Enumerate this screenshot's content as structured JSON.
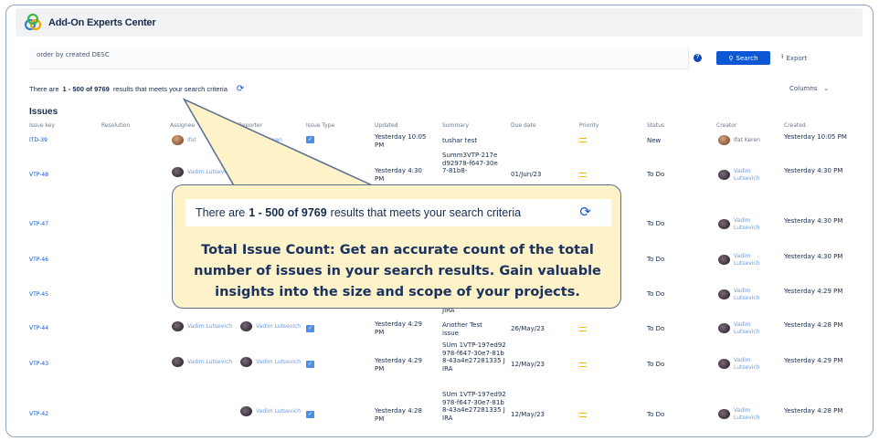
{
  "app": {
    "title": "Add-On Experts Center"
  },
  "query": {
    "text": "order by created DESC"
  },
  "toolbar": {
    "help": "?",
    "search_label": "Search",
    "export_label": "Export",
    "columns_label": "Columns"
  },
  "results": {
    "prefix": "There are",
    "range": "1 - 500 of 9769",
    "suffix": "results that meets your search criteria"
  },
  "issues": {
    "heading": "Issues",
    "columns": [
      "Issue key",
      "Resolution",
      "Assignee",
      "Reporter",
      "Issue Type",
      "Updated",
      "Summary",
      "Due date",
      "Priority",
      "Status",
      "Creator",
      "Created"
    ],
    "rows": [
      {
        "key": "ITD-39",
        "assignee": "Ifat",
        "reporter": "Ifat Keren",
        "updated": "Yesterday 10:05 PM",
        "summary": "tushar test",
        "due": "",
        "status": "New",
        "creator": "Ifat Keren",
        "created": "Yesterday 10:05 PM"
      },
      {
        "key": "VTP-48",
        "assignee": "Vadim Lutsevich",
        "reporter": "",
        "updated": "Yesterday 4:30 PM",
        "summary": "Summ3VTP-217ed92978-f647-30e7-81b8-",
        "due": "01/Jun/23",
        "status": "To Do",
        "creator": "Vadim Lutsevich",
        "created": "Yesterday 4:30 PM"
      },
      {
        "key": "VTP-47",
        "status": "To Do",
        "creator": "Vadim Lutsevich",
        "created": "Yesterday 4:30 PM"
      },
      {
        "key": "VTP-46",
        "status": "To Do",
        "creator": "Vadim Lutsevich",
        "created": "Yesterday 4:30 PM"
      },
      {
        "key": "VTP-45",
        "status": "To Do",
        "creator": "Vadim Lutsevich",
        "created": "Yesterday 4:29 PM"
      },
      {
        "key": "VTP-44",
        "assignee": "Vadim Lutsevich",
        "reporter": "Vadim Lutsevich",
        "updated": "Yesterday 4:29 PM",
        "summary_top": "JIRA",
        "summary": "Another Test issue",
        "due": "26/May/23",
        "status": "To Do",
        "creator": "Vadim Lutsevich",
        "created": "Yesterday 4:28 PM"
      },
      {
        "key": "VTP-43",
        "assignee": "Vadim Lutsevich",
        "reporter": "Vadim Lutsevich",
        "updated": "Yesterday 4:29 PM",
        "summary": "SUm 1VTP-197ed92978-f647-30e7-81b8-43a4e27281335 JIRA",
        "due": "12/May/23",
        "status": "To Do",
        "creator": "Vadim Lutsevich",
        "created": "Yesterday 4:29 PM"
      },
      {
        "key": "VTP-42",
        "assignee": "",
        "reporter": "Vadim Lutsevich",
        "updated": "Yesterday 4:28 PM",
        "summary": "SUm 1VTP-197ed92978-f647-30e7-81b8-43a4e27281335 JIRA",
        "due": "12/May/23",
        "status": "To Do",
        "creator": "Vadim Lutsevich",
        "created": "Yesterday 4:28 PM"
      }
    ]
  },
  "callout": {
    "prefix": "There are",
    "range": "1 - 500 of 9769",
    "suffix": "results that meets your search criteria",
    "lines": [
      "Total Issue Count: Get an accurate count of the total",
      "number of issues in your search results. Gain valuable",
      "insights into the size and scope of your projects."
    ]
  },
  "colors": {
    "accent": "#0c57d4",
    "callout_bg": "#fdf2c8",
    "callout_text": "#1a3260",
    "priority": "#f5b400"
  }
}
